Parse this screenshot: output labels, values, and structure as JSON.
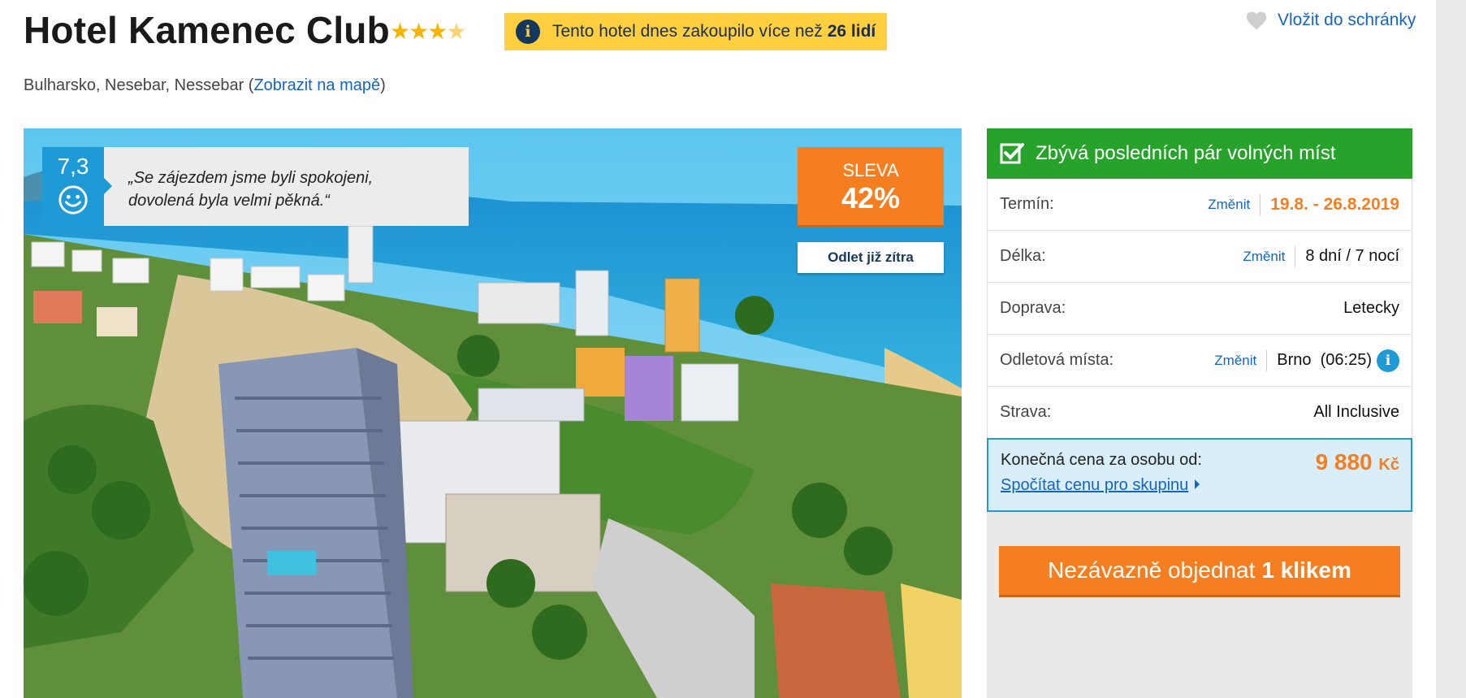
{
  "header": {
    "title": "Hotel Kamenec Club",
    "rating_stars": 3.5,
    "notice_text": "Tento hotel dnes zakoupilo více než",
    "notice_bold": "26 lidí",
    "wishlist_label": "Vložit do schránky"
  },
  "location": {
    "prefix": "Bulharsko, Nesebar, Nessebar (",
    "map_link": "Zobrazit na mapě",
    "suffix": ")"
  },
  "review": {
    "score": "7,3",
    "quote_line1": "„Se zájezdem jsme byli spokojeni,",
    "quote_line2": "dovolená byla velmi pěkná.“"
  },
  "discount": {
    "label": "SLEVA",
    "value": "42%"
  },
  "departure_badge": "Odlet již zítra",
  "booking": {
    "availability": "Zbývá posledních pár volných míst",
    "change_label": "Změnit",
    "rows": [
      {
        "label": "Termín:",
        "value": "19.8. - 26.8.2019"
      },
      {
        "label": "Délka:",
        "value": "8 dní / 7 nocí"
      },
      {
        "label": "Doprava:",
        "value": "Letecky"
      },
      {
        "label": "Odletová místa:",
        "value": "Brno  (06:25)"
      },
      {
        "label": "Strava:",
        "value": "All Inclusive"
      }
    ],
    "price_label": "Konečná cena za osobu od:",
    "price_value": "9 880",
    "price_currency": "Kč",
    "group_link": "Spočítat cenu pro skupinu",
    "order_prefix": "Nezávazně objednat",
    "order_bold": "1 klikem"
  },
  "colors": {
    "accent_orange": "#f57f20",
    "accent_blue": "#1e9ad6",
    "available_green": "#27a22a",
    "notice_yellow": "#ffcf40",
    "link_blue": "#1565c0"
  }
}
